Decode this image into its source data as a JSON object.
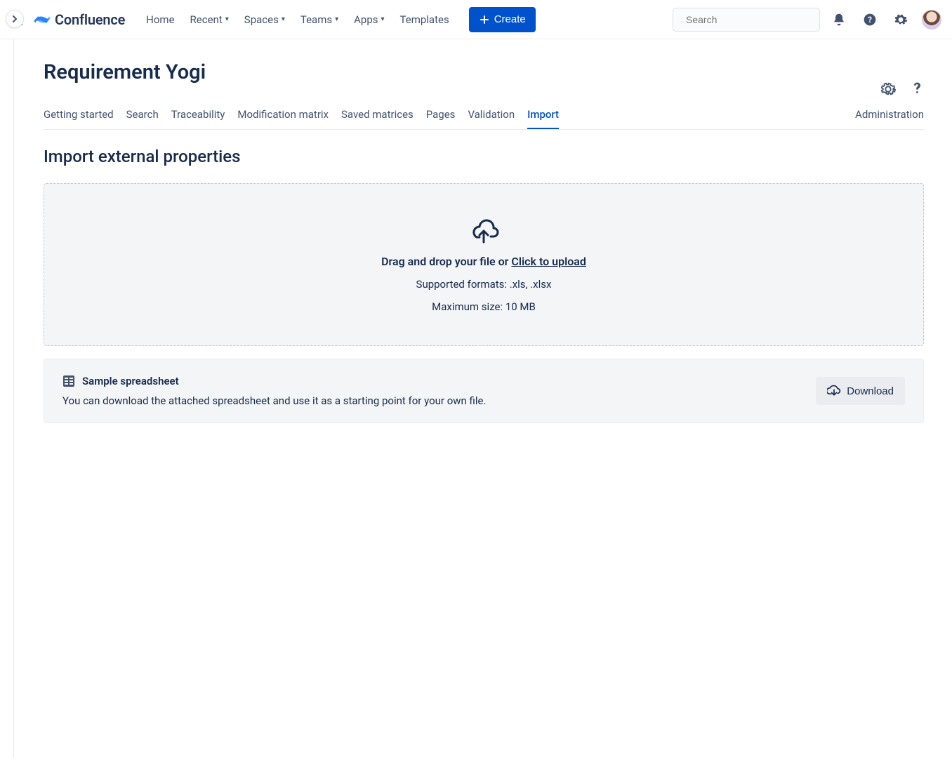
{
  "header": {
    "brand": "Confluence",
    "nav": [
      "Home",
      "Recent",
      "Spaces",
      "Teams",
      "Apps",
      "Templates"
    ],
    "nav_has_dropdown": [
      false,
      true,
      true,
      true,
      true,
      false
    ],
    "create": "Create",
    "search_placeholder": "Search"
  },
  "page": {
    "title": "Requirement Yogi",
    "tabs": [
      "Getting started",
      "Search",
      "Traceability",
      "Modification matrix",
      "Saved matrices",
      "Pages",
      "Validation",
      "Import"
    ],
    "active_tab_index": 7,
    "admin_tab": "Administration",
    "section_title": "Import external properties"
  },
  "dropzone": {
    "prefix": "Drag and drop your file or ",
    "link": "Click to upload",
    "formats": "Supported formats: .xls, .xlsx",
    "max": "Maximum size: 10 MB"
  },
  "sample": {
    "title": "Sample spreadsheet",
    "desc": "You can download the attached spreadsheet and use it as a starting point for your own file.",
    "download": "Download"
  }
}
